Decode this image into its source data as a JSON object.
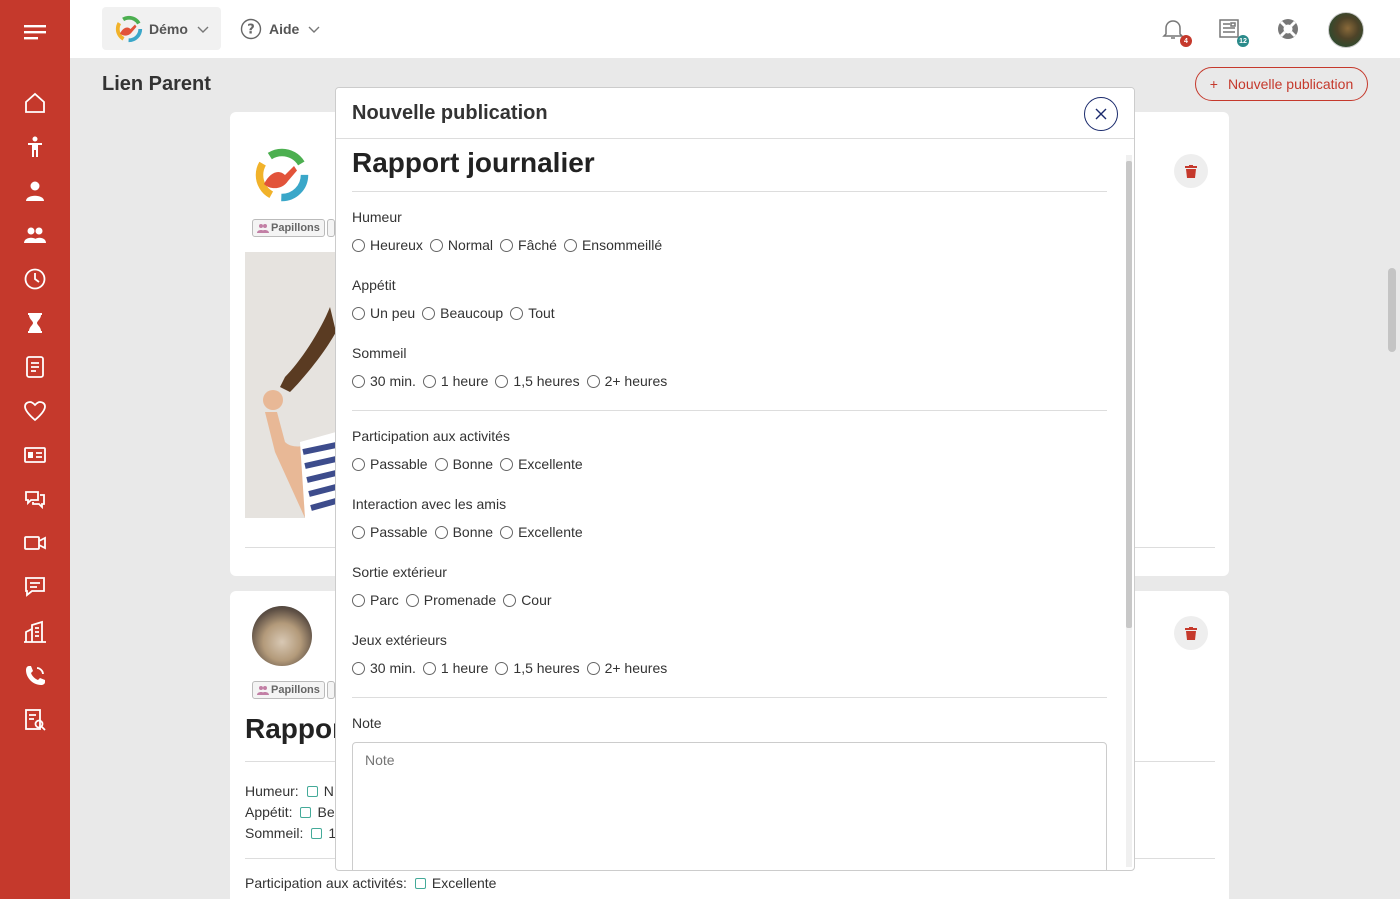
{
  "topbar": {
    "center_label": "Démo",
    "help_label": "Aide",
    "notifications_count": "4",
    "news_count": "12"
  },
  "page": {
    "title": "Lien Parent",
    "new_publication_label": "Nouvelle publication"
  },
  "background": {
    "tag": "Papillons",
    "report_title_partial": "Rappor",
    "rows": [
      {
        "label": "Humeur:",
        "value": "N"
      },
      {
        "label": "Appétit:",
        "value": "Be"
      },
      {
        "label": "Sommeil:",
        "value": "1"
      }
    ],
    "participation_label": "Participation aux activités:",
    "participation_value": "Excellente"
  },
  "modal": {
    "title": "Nouvelle publication",
    "report_title": "Rapport journalier",
    "questions": [
      {
        "label": "Humeur",
        "options": [
          "Heureux",
          "Normal",
          "Fâché",
          "Ensommeillé"
        ]
      },
      {
        "label": "Appétit",
        "options": [
          "Un peu",
          "Beaucoup",
          "Tout"
        ]
      },
      {
        "label": "Sommeil",
        "options": [
          "30 min.",
          "1 heure",
          "1,5 heures",
          "2+ heures"
        ]
      },
      {
        "label": "Participation aux activités",
        "options": [
          "Passable",
          "Bonne",
          "Excellente"
        ]
      },
      {
        "label": "Interaction avec les amis",
        "options": [
          "Passable",
          "Bonne",
          "Excellente"
        ]
      },
      {
        "label": "Sortie extérieur",
        "options": [
          "Parc",
          "Promenade",
          "Cour"
        ]
      },
      {
        "label": "Jeux extérieurs",
        "options": [
          "30 min.",
          "1 heure",
          "1,5 heures",
          "2+ heures"
        ]
      }
    ],
    "note_label": "Note",
    "note_placeholder": "Note"
  },
  "colors": {
    "sidebar": "#c5392c",
    "accent": "#c5392c",
    "close_button": "#1a2a6c"
  },
  "sidebar_icons": [
    "menu-icon",
    "home-icon",
    "child-icon",
    "person-icon",
    "group-icon",
    "clock-icon",
    "hourglass-icon",
    "checklist-icon",
    "heart-icon",
    "id-card-icon",
    "chat-icon",
    "video-icon",
    "message-icon",
    "building-icon",
    "phone-icon",
    "report-icon"
  ]
}
